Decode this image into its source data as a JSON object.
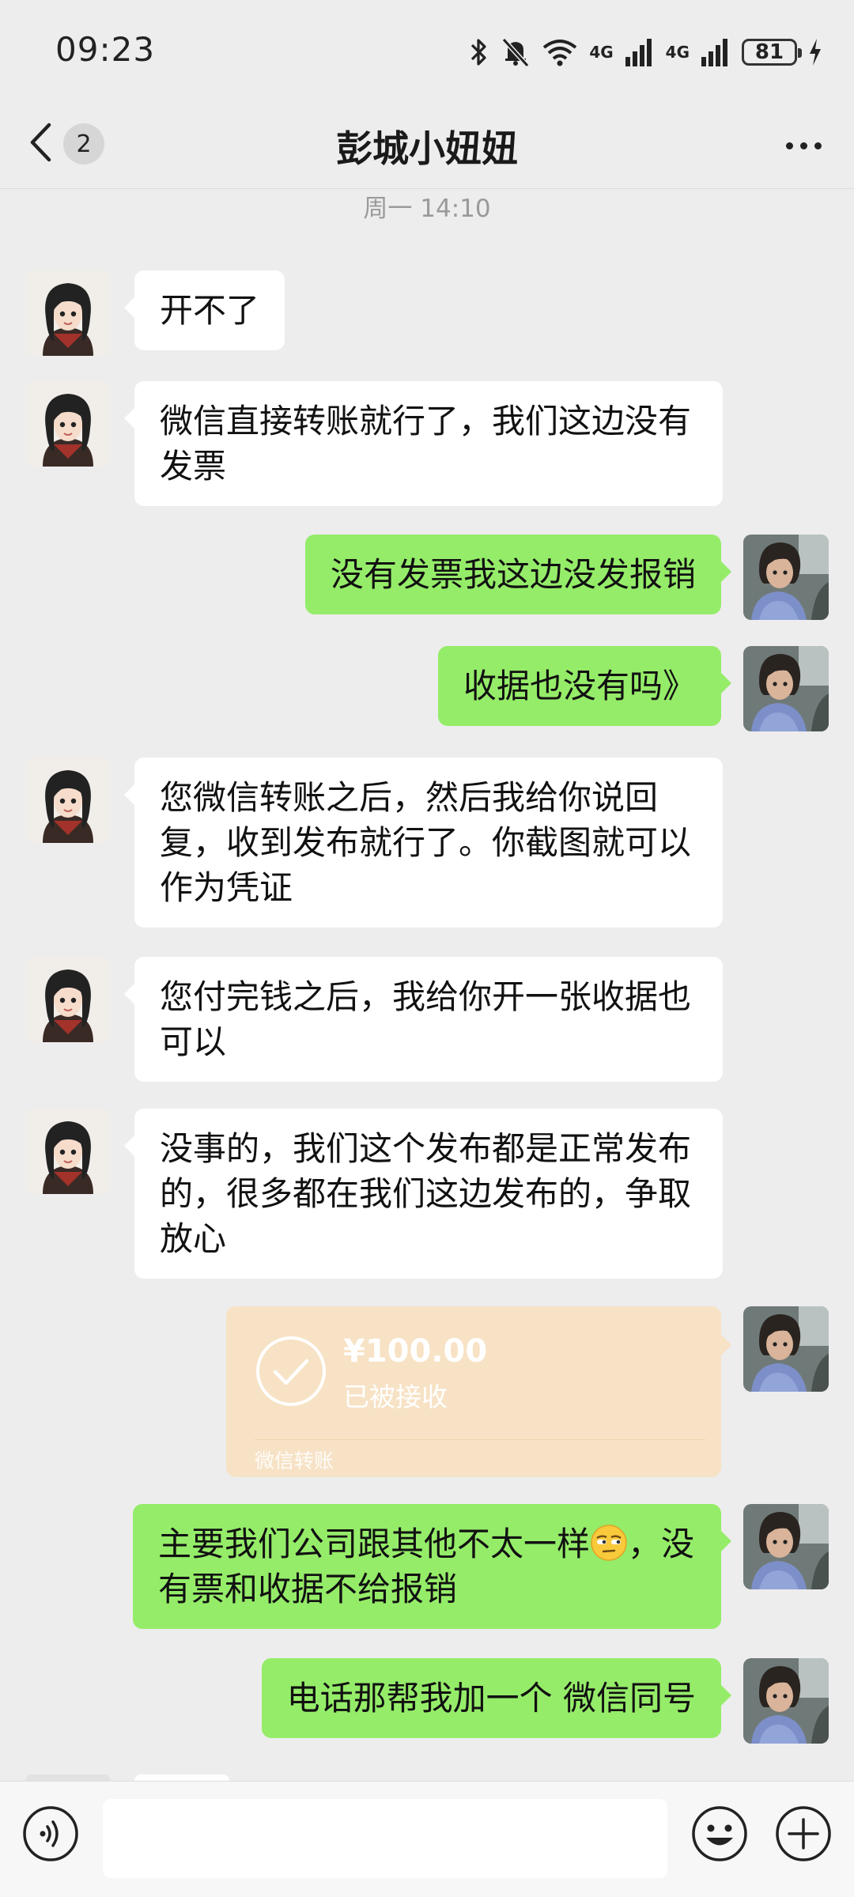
{
  "status_bar": {
    "time": "09:23",
    "network_1": "4G",
    "network_2": "4G",
    "battery": "81"
  },
  "nav": {
    "unread_count": "2",
    "title": "彭城小妞妞"
  },
  "timestamp": "周一 14:10",
  "messages": [
    {
      "side": "in",
      "text": "开不了"
    },
    {
      "side": "in",
      "text": "微信直接转账就行了，我们这边没有发票"
    },
    {
      "side": "out",
      "text": "没有发票我这边没发报销"
    },
    {
      "side": "out",
      "text": "收据也没有吗》"
    },
    {
      "side": "in",
      "text": "您微信转账之后，然后我给你说回复，收到发布就行了。你截图就可以作为凭证"
    },
    {
      "side": "in",
      "text": "您付完钱之后，我给你开一张收据也可以"
    },
    {
      "side": "in",
      "text": "没事的，我们这个发布都是正常发布的，很多都在我们这边发布的，争取放心"
    },
    {
      "side": "out",
      "type": "transfer",
      "amount": "¥100.00",
      "status": "已被接收",
      "label": "微信转账"
    },
    {
      "side": "out",
      "text_part1": "主要我们公司跟其他不太一样",
      "emoji": "unamused-face-emoji",
      "text_part2": "，没有票和收据不给报销"
    },
    {
      "side": "out",
      "text": "电话那帮我加一个 微信同号"
    }
  ],
  "input": {
    "value": "",
    "placeholder": ""
  },
  "icons": {
    "back": "chevron-left-icon",
    "more": "more-dots-icon",
    "voice": "voice-icon",
    "emoji": "smiley-icon",
    "plus": "plus-circle-icon",
    "transfer_check": "check-circle-icon"
  },
  "colors": {
    "out_bubble": "#95ec69",
    "in_bubble": "#ffffff",
    "background": "#ededed",
    "transfer": "#f7e2c5"
  }
}
